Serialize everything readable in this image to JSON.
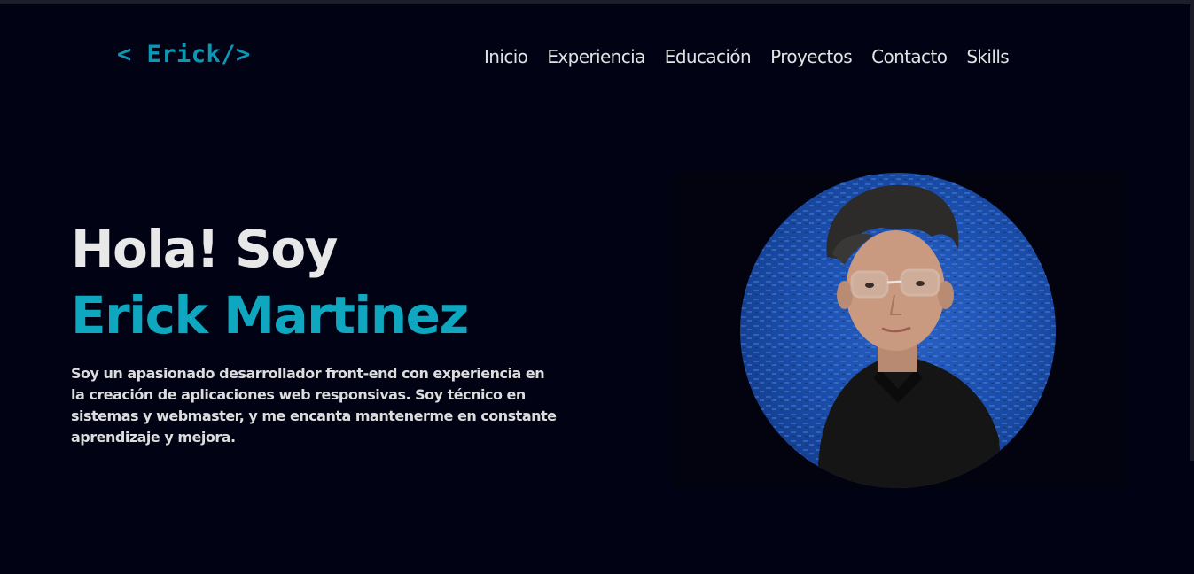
{
  "logo": {
    "text": "< Erick/>"
  },
  "nav": {
    "items": [
      {
        "label": "Inicio"
      },
      {
        "label": "Experiencia"
      },
      {
        "label": "Educación"
      },
      {
        "label": "Proyectos"
      },
      {
        "label": "Contacto"
      },
      {
        "label": "Skills"
      }
    ]
  },
  "hero": {
    "greeting": "Hola! Soy",
    "name": "Erick Martinez",
    "description": "Soy un apasionado desarrollador front-end con experiencia en la creación de aplicaciones web responsivas. Soy técnico en sistemas y webmaster, y me encanta mantenerme en constante aprendizaje y mejora."
  },
  "colors": {
    "background": "#010214",
    "accent": "#0fa7bf",
    "text": "#e6e6e6"
  }
}
